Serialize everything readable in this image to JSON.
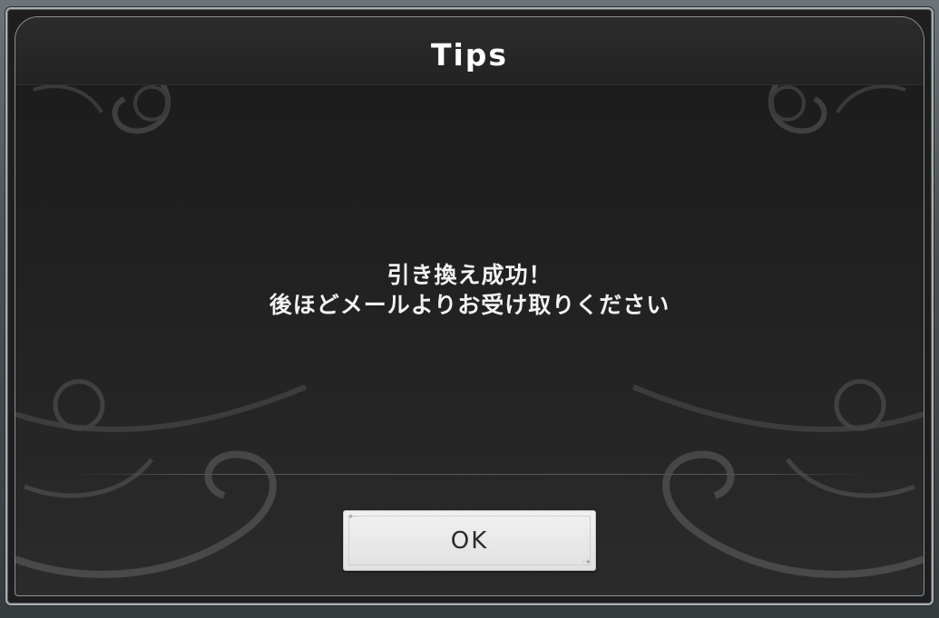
{
  "dialog": {
    "title": "Tips",
    "message_lines": [
      "引き換え成功！",
      "後ほどメールよりお受け取りください"
    ],
    "ok_label": "OK"
  }
}
